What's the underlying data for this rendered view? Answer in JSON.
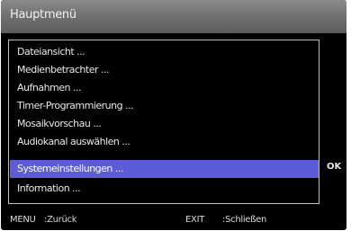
{
  "window": {
    "title": "Hauptmenü"
  },
  "menu": {
    "items": [
      {
        "label": "Dateiansicht ...",
        "selected": false
      },
      {
        "label": "Medienbetrachter ...",
        "selected": false
      },
      {
        "label": "Aufnahmen ...",
        "selected": false
      },
      {
        "label": "Timer-Programmierung ...",
        "selected": false
      },
      {
        "label": "Mosaikvorschau ...",
        "selected": false
      },
      {
        "label": "Audiokanal auswählen ...",
        "selected": false
      },
      {
        "label": "Systemeinstellungen ...",
        "selected": true
      },
      {
        "label": "Information ...",
        "selected": false
      }
    ],
    "highlight_color": "#5d5cd6"
  },
  "ok_hint": "OK",
  "footer": {
    "menu_key": "MENU",
    "menu_action": ":Zurück",
    "exit_key": "EXIT",
    "exit_action": ":Schließen"
  }
}
